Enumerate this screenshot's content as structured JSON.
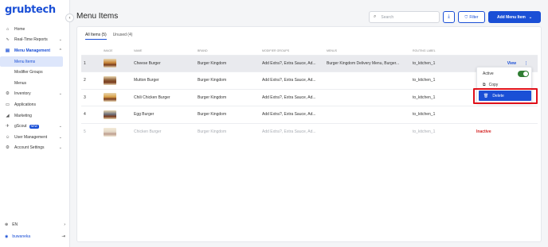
{
  "app": {
    "logo": "grubtech"
  },
  "sidebar": {
    "items": [
      {
        "label": "Home",
        "icon": "home-icon",
        "glyph": "⌂",
        "chevron": false
      },
      {
        "label": "Real-Time Reports",
        "icon": "pulse-icon",
        "glyph": "∿",
        "chevron": true
      },
      {
        "label": "Menu Management",
        "icon": "menu-book-icon",
        "glyph": "▤",
        "chevron": true,
        "active": true
      },
      {
        "label": "Inventory",
        "icon": "gear-icon",
        "glyph": "⚙",
        "chevron": true
      },
      {
        "label": "Applications",
        "icon": "monitor-icon",
        "glyph": "▭",
        "chevron": false
      },
      {
        "label": "Marketing",
        "icon": "megaphone-icon",
        "glyph": "◢",
        "chevron": false
      },
      {
        "label": "gScout",
        "icon": "gscout-icon",
        "glyph": "✈",
        "chevron": true,
        "badge": "NEW"
      },
      {
        "label": "User Management",
        "icon": "user-icon",
        "glyph": "☺",
        "chevron": true
      },
      {
        "label": "Account Settings",
        "icon": "settings-icon",
        "glyph": "⚙",
        "chevron": true
      }
    ],
    "subitems": [
      {
        "label": "Menu Items",
        "active": true
      },
      {
        "label": "Modifier Groups"
      },
      {
        "label": "Menus"
      }
    ],
    "language": "EN",
    "user": "buwaneka"
  },
  "header": {
    "title": "Menu Items",
    "search_placeholder": "Search",
    "filter_label": "Filter",
    "add_label": "Add Menu Item"
  },
  "tabs": [
    {
      "label": "All Items (5)",
      "active": true
    },
    {
      "label": "Unused (4)"
    }
  ],
  "table": {
    "columns": [
      "IMAGE",
      "NAME",
      "BRAND",
      "MODIFIER GROUPS",
      "MENUS",
      "ROUTING LABEL"
    ],
    "rows": [
      {
        "num": "1",
        "name": "Cheese Burger",
        "brand": "Burger Kingdom",
        "modifiers": "Add Extra?, Extra Sauce, Ad...",
        "menus": "Burger Kingdom Delivery Menu, Burger...",
        "routing": "to_kitchen_1",
        "status": "",
        "action": "View",
        "thumb": "#c9873a"
      },
      {
        "num": "2",
        "name": "Mutton Burger",
        "brand": "Burger Kingdom",
        "modifiers": "Add Extra?, Extra Sauce, Ad...",
        "menus": "",
        "routing": "to_kitchen_1",
        "status": "",
        "action": "",
        "thumb": "#8a5a34"
      },
      {
        "num": "3",
        "name": "Chili Chicken Burger",
        "brand": "Burger Kingdom",
        "modifiers": "Add Extra?, Extra Sauce, Ad...",
        "menus": "",
        "routing": "to_kitchen_1",
        "status": "",
        "action": "",
        "thumb": "#d9a24a"
      },
      {
        "num": "4",
        "name": "Egg Burger",
        "brand": "Burger Kingdom",
        "modifiers": "Add Extra?, Extra Sauce, Ad...",
        "menus": "",
        "routing": "to_kitchen_1",
        "status": "",
        "action": "",
        "thumb": "#6b6f7a"
      },
      {
        "num": "5",
        "name": "Chicken Burger",
        "brand": "Burger Kingdom",
        "modifiers": "Add Extra?, Extra Sauce, Ad...",
        "menus": "",
        "routing": "to_kitchen_1",
        "status": "Inactive",
        "action": "",
        "thumb": "#c9b28f"
      }
    ]
  },
  "popover": {
    "active_label": "Active",
    "active_on": true,
    "copy_label": "Copy",
    "delete_label": "Delete"
  },
  "colors": {
    "accent": "#1a4fd6",
    "danger": "#d42323",
    "toggle_on": "#2f7d32",
    "highlight": "#e0101a"
  }
}
